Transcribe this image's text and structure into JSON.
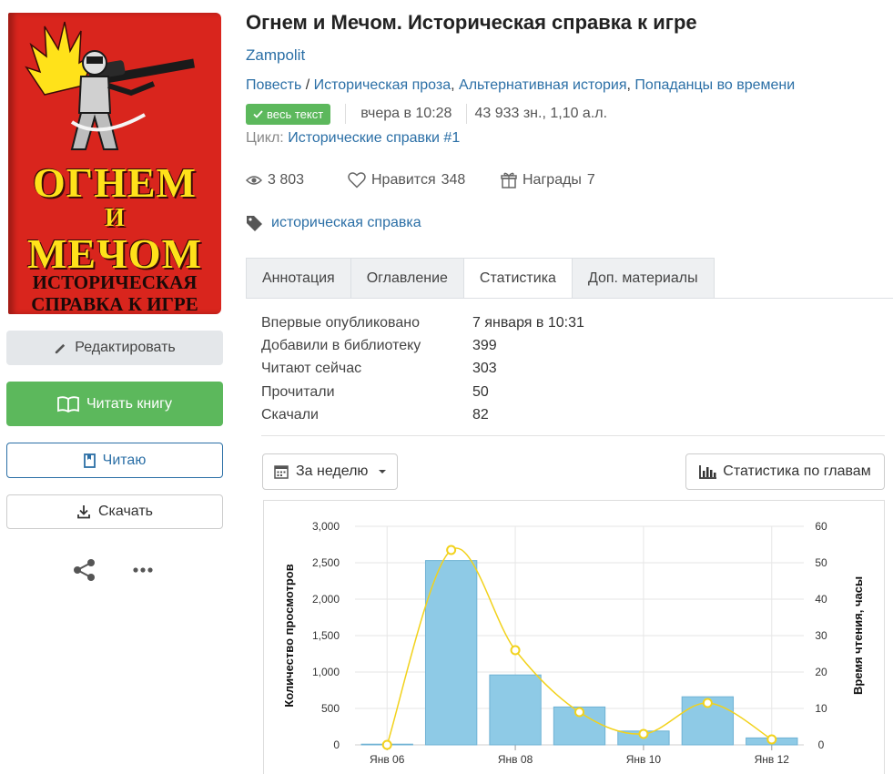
{
  "cover": {
    "title_line1": "ОГНЕМ",
    "title_line2": "И",
    "title_line3": "МЕЧОМ",
    "subtitle_line1": "ИСТОРИЧЕСКАЯ",
    "subtitle_line2": "СПРАВКА К ИГРЕ",
    "bg_color": "#d9251d",
    "title_color": "#ffe21a"
  },
  "actions": {
    "edit": "Редактировать",
    "read": "Читать книгу",
    "reading": "Читаю",
    "download": "Скачать",
    "share_icon": "share-icon",
    "more_icon": "more-icon"
  },
  "book": {
    "title": "Огнем и Мечом. Историческая справка к игре",
    "author": "Zampolit",
    "genre_first": "Повесть",
    "genre_sep": " / ",
    "genres": [
      "Историческая проза",
      "Альтернативная история",
      "Попаданцы во времени"
    ],
    "badge": "весь текст",
    "updated": "вчера в 10:28",
    "size": "43 933 зн., 1,10 а.л.",
    "cycle_label": "Цикл:",
    "cycle_name": "Исторические справки #1",
    "views": "3 803",
    "likes_label": "Нравится",
    "likes": "348",
    "awards_label": "Награды",
    "awards": "7",
    "tag": "историческая справка"
  },
  "tabs": [
    "Аннотация",
    "Оглавление",
    "Статистика",
    "Доп. материалы"
  ],
  "active_tab": "Статистика",
  "stats": [
    {
      "label": "Впервые опубликовано",
      "value": "7 января в 10:31"
    },
    {
      "label": "Добавили в библиотеку",
      "value": "399"
    },
    {
      "label": "Читают сейчас",
      "value": "303"
    },
    {
      "label": "Прочитали",
      "value": "50"
    },
    {
      "label": "Скачали",
      "value": "82"
    }
  ],
  "controls": {
    "period": "За неделю",
    "chapters": "Статистика по главам"
  },
  "colors": {
    "accent": "#2b6fa6",
    "green": "#5cb85c",
    "bar": "#8ecae6",
    "line": "#f2d21c"
  },
  "chart_data": {
    "type": "bar",
    "xlabel": "",
    "ylabel": "Количество просмотров",
    "y2label": "Время чтения, часы",
    "x": [
      "2024-01-06",
      "2024-01-07",
      "2024-01-08",
      "2024-01-09",
      "2024-01-10",
      "2024-01-11",
      "2024-01-12"
    ],
    "x_tick_labels": [
      "Янв 06",
      "Янв 08",
      "Янв 10",
      "Янв 12"
    ],
    "x_ticks_at": [
      "2024-01-06",
      "2024-01-08",
      "2024-01-10",
      "2024-01-12"
    ],
    "ylim": [
      0,
      3000
    ],
    "y_ticks": [
      "0",
      "500",
      "1,000",
      "1,500",
      "2,000",
      "2,500",
      "3,000"
    ],
    "y2lim": [
      0,
      60
    ],
    "y2_ticks": [
      "0",
      "10",
      "20",
      "30",
      "40",
      "50",
      "60"
    ],
    "series": [
      {
        "type": "bar",
        "axis": "left",
        "values": [
          10,
          2530,
          960,
          520,
          190,
          660,
          95
        ]
      },
      {
        "type": "line",
        "axis": "right",
        "values": [
          0,
          53.5,
          26,
          9,
          3,
          11.5,
          1.5
        ]
      }
    ],
    "grid": true
  }
}
